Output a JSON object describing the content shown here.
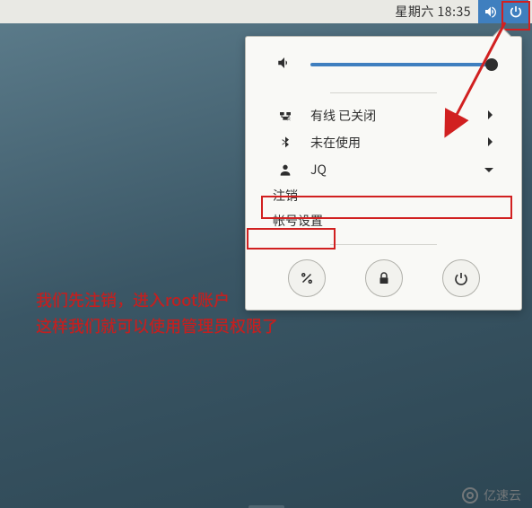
{
  "topbar": {
    "datetime": "星期六 18:35"
  },
  "panel": {
    "volume_percent": 100,
    "items": {
      "wired": {
        "label": "有线 已关闭"
      },
      "bluetooth": {
        "label": "未在使用"
      },
      "user": {
        "label": "JQ"
      }
    },
    "user_menu": {
      "logout": "注销",
      "account_settings": "帐号设置"
    }
  },
  "annotations": {
    "instruction_line1": "我们先注销，进入root账户",
    "instruction_line2": "这样我们就可以使用管理员权限了"
  },
  "watermark": {
    "text": "亿速云"
  }
}
